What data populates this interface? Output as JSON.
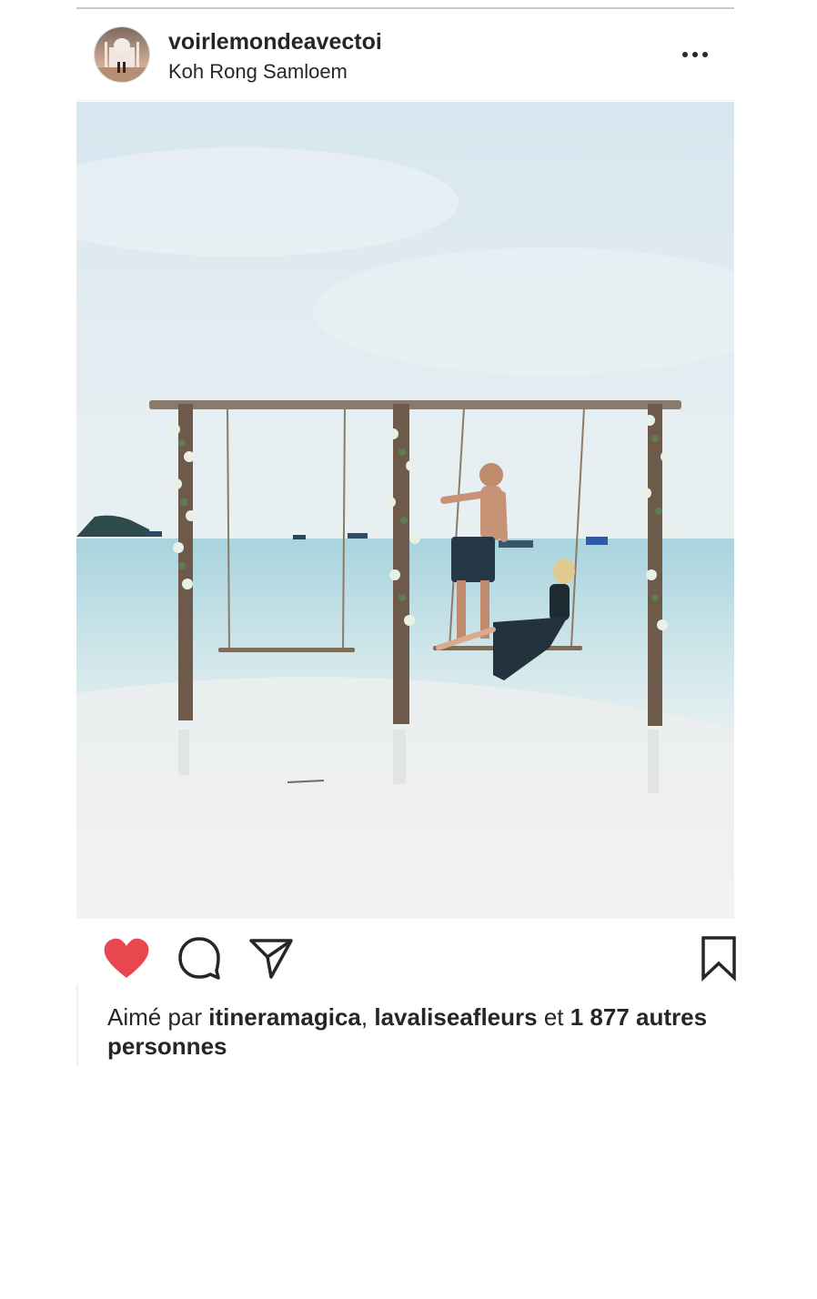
{
  "post": {
    "username": "voirlemondeavectoi",
    "location": "Koh Rong Samloem",
    "image_alt": "Couple on a flower-decorated wooden swing set on a white sand beach",
    "liked": true,
    "likes": {
      "prefix": "Aimé par ",
      "user1": "itineramagica",
      "sep": ", ",
      "user2": "lavaliseafleurs",
      "conj": " et ",
      "others": "1 877 autres personnes"
    }
  },
  "icons": {
    "more": "more-options-icon",
    "like": "heart-icon",
    "comment": "comment-icon",
    "share": "send-icon",
    "save": "bookmark-icon"
  },
  "colors": {
    "like_red": "#e8474f",
    "text": "#262626",
    "divider": "#c9c9c9"
  }
}
